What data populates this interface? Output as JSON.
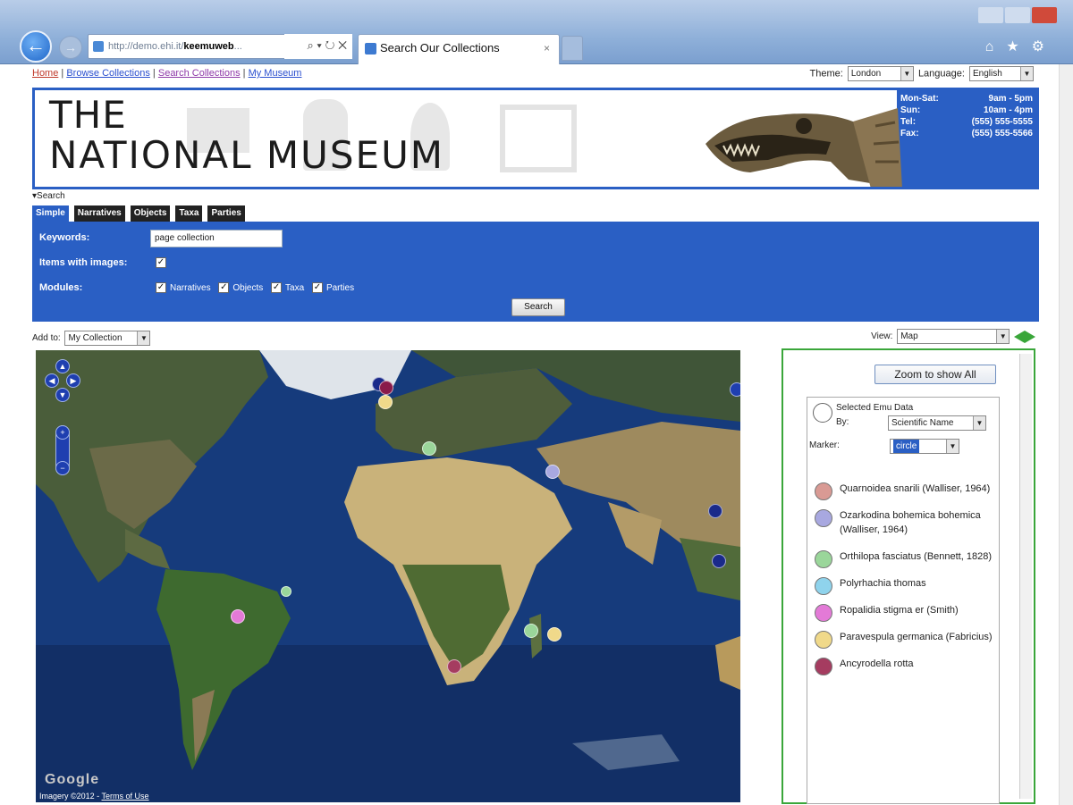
{
  "browser": {
    "address_url": "http://demo.ehi.it/",
    "address_bold": "keemuweb",
    "address_suffix": "...",
    "tab_title": "Search Our Collections",
    "tab_close": "×"
  },
  "nav": {
    "home": "Home",
    "browse": "Browse Collections",
    "search": "Search Collections",
    "my_museum": "My Museum"
  },
  "prefs": {
    "theme_label": "Theme:",
    "theme_value": "London",
    "language_label": "Language:",
    "language_value": "English"
  },
  "banner": {
    "line1": "THE",
    "line2": "NATIONAL MUSEUM",
    "hours": [
      {
        "label": "Mon-Sat:",
        "value": "9am - 5pm"
      },
      {
        "label": "Sun:",
        "value": "10am - 4pm"
      },
      {
        "label": "Tel:",
        "value": "(555) 555-5555"
      },
      {
        "label": "Fax:",
        "value": "(555) 555-5566"
      }
    ]
  },
  "search": {
    "toggle": "Search",
    "tabs": [
      "Simple",
      "Narratives",
      "Objects",
      "Taxa",
      "Parties"
    ],
    "keywords_label": "Keywords:",
    "keywords_value": "page collection",
    "images_label": "Items with images:",
    "modules_label": "Modules:",
    "modules": [
      "Narratives",
      "Objects",
      "Taxa",
      "Parties"
    ],
    "button": "Search"
  },
  "addto": {
    "label": "Add to:",
    "value": "My Collection"
  },
  "view": {
    "label": "View:",
    "value": "Map"
  },
  "map": {
    "credit": "Imagery ©2012",
    "terms": "Terms of Use",
    "brand": "Google"
  },
  "legend": {
    "zoom_all": "Zoom to show All",
    "selected_text": "Selected Emu Data",
    "by_label": "By:",
    "by_value": "Scientific Name",
    "marker_label": "Marker:",
    "marker_value": "circle",
    "entries": [
      {
        "name": "Quarnoidea snarili (Walliser, 1964)",
        "color": "#d99a94"
      },
      {
        "name": "Ozarkodina bohemica bohemica (Walliser, 1964)",
        "color": "#a8a8e0"
      },
      {
        "name": "Orthilopa fasciatus (Bennett, 1828)",
        "color": "#9ad69a"
      },
      {
        "name": "Polyrhachia thomas",
        "color": "#8fd3ec"
      },
      {
        "name": "Ropalidia stigma er (Smith)",
        "color": "#e37ad7"
      },
      {
        "name": "Paravespula germanica (Fabricius)",
        "color": "#f0d98a"
      },
      {
        "name": "Ancyrodella rotta",
        "color": "#a53c60"
      }
    ]
  }
}
